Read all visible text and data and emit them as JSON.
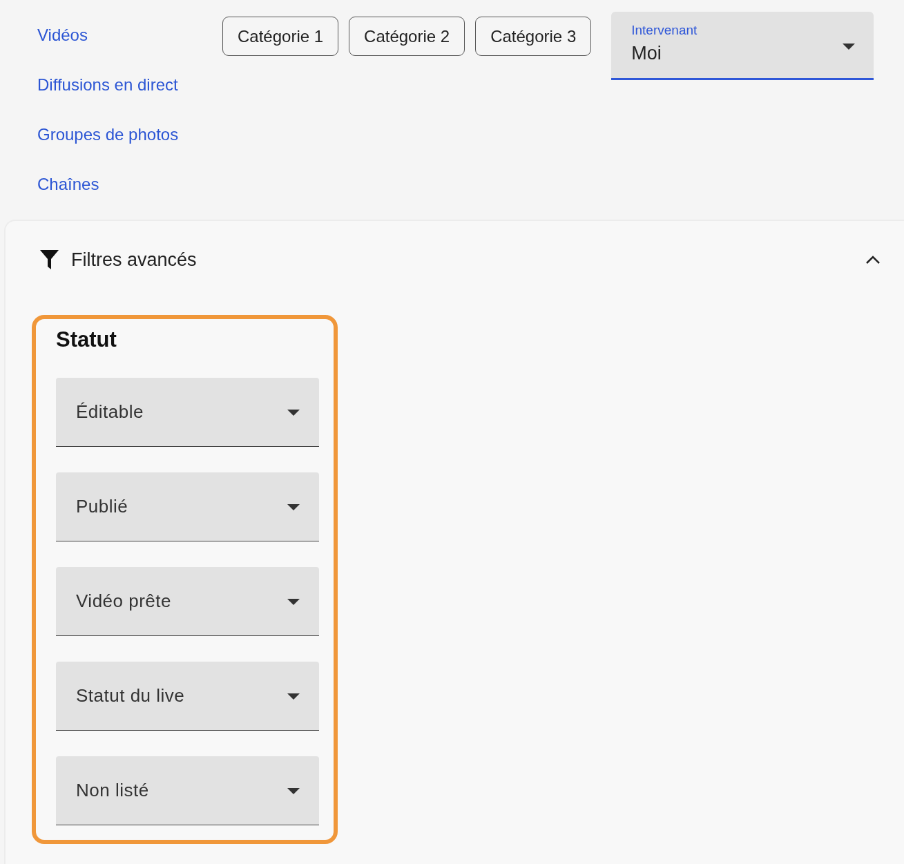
{
  "nav_links": [
    "Vidéos",
    "Diffusions en direct",
    "Groupes de photos",
    "Chaînes"
  ],
  "category_chips": [
    "Catégorie 1",
    "Catégorie 2",
    "Catégorie 3"
  ],
  "speaker_select": {
    "label": "Intervenant",
    "value": "Moi"
  },
  "advanced_filters": {
    "title": "Filtres avancés",
    "expanded": true,
    "status_group": {
      "title": "Statut",
      "selects": [
        "Éditable",
        "Publié",
        "Vidéo prête",
        "Statut du live",
        "Non listé"
      ]
    }
  }
}
